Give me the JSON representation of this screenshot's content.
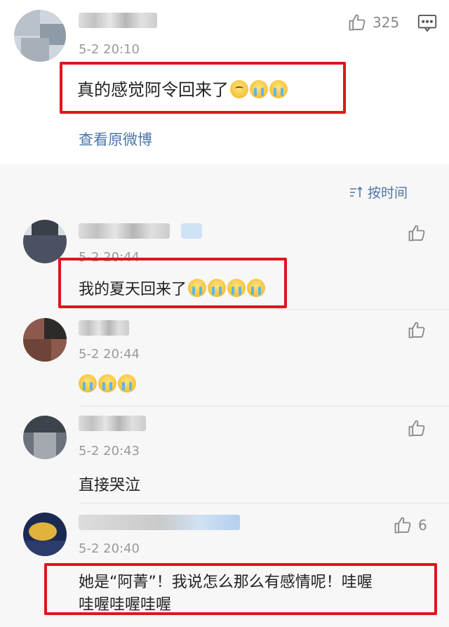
{
  "top_post": {
    "time": "5-2 20:10",
    "likes": "325",
    "text": "真的感觉阿令回来了",
    "view_original": "查看原微博"
  },
  "sort": {
    "label": "按时间"
  },
  "comments": [
    {
      "time": "5-2 20:44",
      "text": "我的夏天回来了",
      "likes": ""
    },
    {
      "time": "5-2 20:44",
      "text": "",
      "likes": ""
    },
    {
      "time": "5-2 20:43",
      "text": "直接哭泣",
      "likes": ""
    },
    {
      "time": "5-2 20:40",
      "text_line1": "她是“阿菁”！我说怎么那么有感情呢！哇喔",
      "text_line2": "哇喔哇喔哇喔",
      "likes": "6"
    }
  ],
  "colors": {
    "highlight_box": "#e0141e",
    "link": "#4a76a8",
    "meta": "#9a9a9a"
  },
  "icons": [
    "thumbs-up-icon",
    "comment-icon",
    "sort-icon"
  ]
}
